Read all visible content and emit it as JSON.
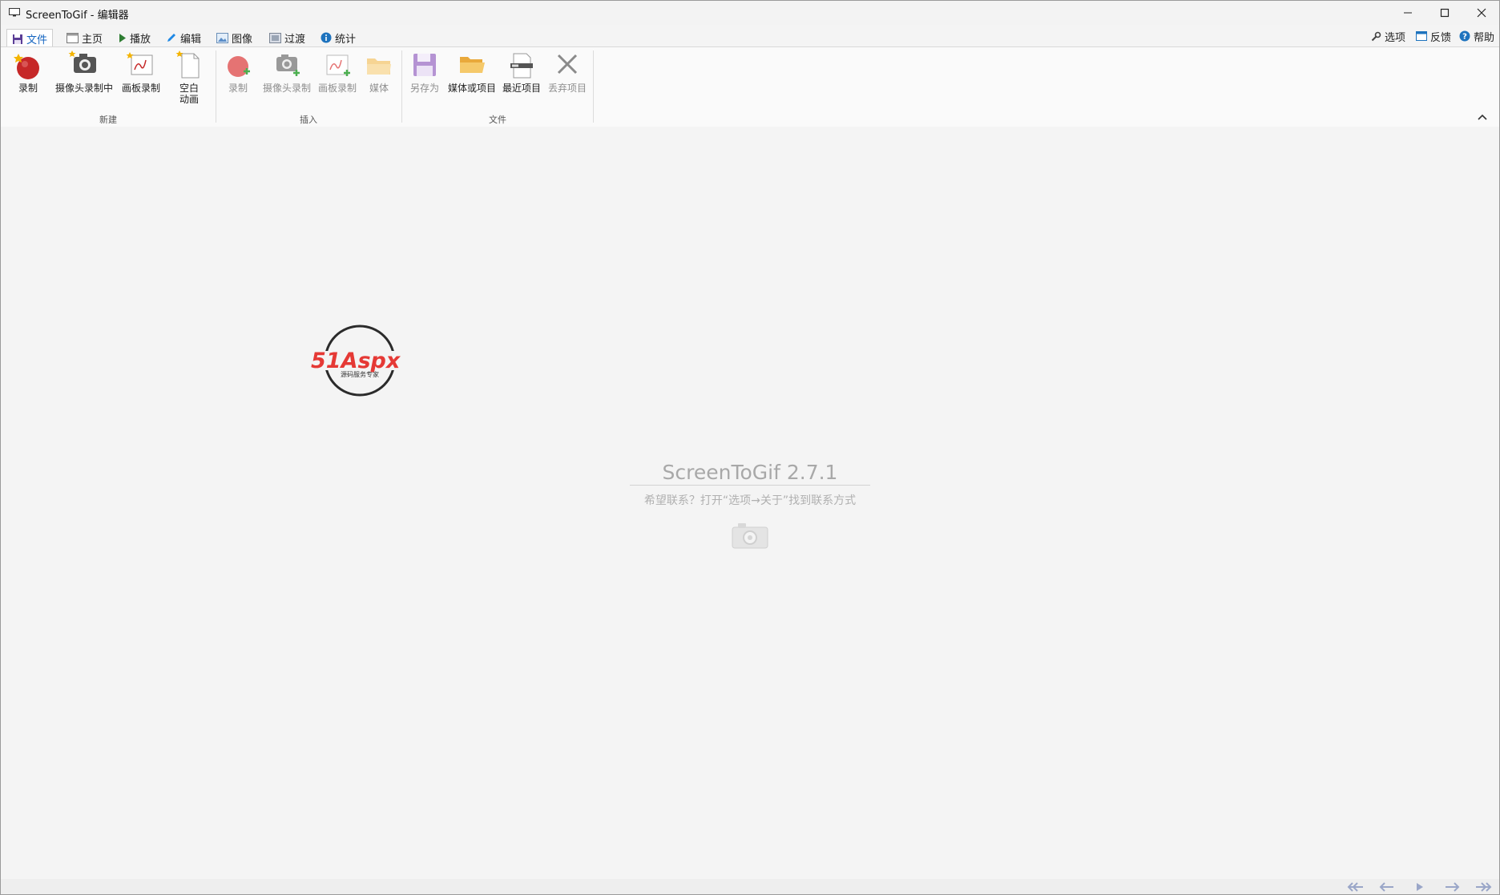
{
  "window": {
    "title": "ScreenToGif - 编辑器",
    "minimize_icon": "minimize-icon",
    "maximize_icon": "maximize-icon",
    "close_icon": "close-icon"
  },
  "tabs": [
    {
      "label": "文件",
      "icon": "save-icon",
      "active": true
    },
    {
      "label": "主页",
      "icon": "home-window-icon"
    },
    {
      "label": "播放",
      "icon": "play-icon"
    },
    {
      "label": "编辑",
      "icon": "pencil-icon"
    },
    {
      "label": "图像",
      "icon": "image-icon"
    },
    {
      "label": "过渡",
      "icon": "transition-icon"
    },
    {
      "label": "统计",
      "icon": "info-icon"
    }
  ],
  "top_right": {
    "options": "选项",
    "feedback": "反馈",
    "help": "帮助"
  },
  "ribbon": {
    "groups": [
      {
        "label": "新建",
        "buttons": [
          {
            "label": "录制",
            "icon": "record-icon"
          },
          {
            "label": "摄像头录制中",
            "icon": "webcam-icon"
          },
          {
            "label": "画板录制",
            "icon": "board-icon"
          },
          {
            "label": "空白\n动画",
            "icon": "blank-page-icon"
          }
        ]
      },
      {
        "label": "插入",
        "buttons": [
          {
            "label": "录制",
            "icon": "record-add-icon"
          },
          {
            "label": "摄像头录制",
            "icon": "webcam-add-icon"
          },
          {
            "label": "画板录制",
            "icon": "board-add-icon"
          },
          {
            "label": "媒体",
            "icon": "folder-icon"
          }
        ]
      },
      {
        "label": "文件",
        "buttons": [
          {
            "label": "另存为",
            "icon": "floppy-icon"
          },
          {
            "label": "媒体或项目",
            "icon": "folder-open-icon"
          },
          {
            "label": "最近项目",
            "icon": "recent-projects-icon"
          },
          {
            "label": "丢弃项目",
            "icon": "discard-icon"
          }
        ]
      }
    ]
  },
  "content": {
    "logo_text": "51Aspx",
    "logo_subtext": "源码服务专家",
    "app_name": "ScreenToGif 2.7.1",
    "hint": "希望联系？打开“选项→关于”找到联系方式"
  },
  "bottom_nav": [
    "first-frame-icon",
    "previous-frame-icon",
    "play-icon",
    "next-frame-icon",
    "last-frame-icon"
  ],
  "colors": {
    "accent": "#1565c0",
    "record_red": "#c62828",
    "floppy_purple": "#9c6fc0",
    "folder_yellow": "#f5c96a"
  }
}
